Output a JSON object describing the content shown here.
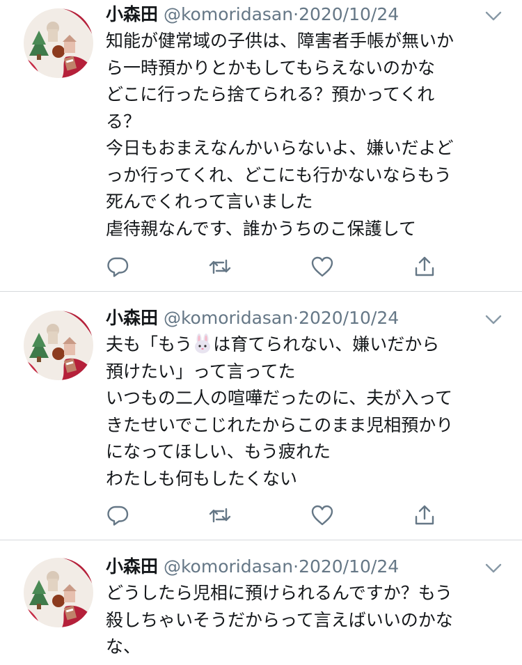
{
  "tweets": [
    {
      "name": "小森田",
      "handle": "@komoridasan",
      "sep": "·",
      "date": "2020/10/24",
      "lines": [
        "知能が健常域の子供は、障害者手帳が無いか",
        "ら一時預かりとかもしてもらえないのかな",
        "どこに行ったら捨てられる？預かってくれ",
        "る？",
        "今日もおまえなんかいらないよ、嫌いだよど",
        "っか行ってくれ、どこにも行かないならもう",
        "死んでくれって言いました",
        "虐待親なんです、誰かうちのこ保護して"
      ]
    },
    {
      "name": "小森田",
      "handle": "@komoridasan",
      "sep": "·",
      "date": "2020/10/24",
      "line1_pre": "夫も「もう",
      "line1_emoji": "rabbit-face-emoji",
      "line1_post": "は育てられない、嫌いだから",
      "lines": [
        "預けたい」って言ってた",
        "いつもの二人の喧嘩だったのに、夫が入って",
        "きたせいでこじれたからこのまま児相預かり",
        "になってほしい、もう疲れた",
        "わたしも何もしたくない"
      ]
    },
    {
      "name": "小森田",
      "handle": "@komoridasan",
      "sep": "·",
      "date": "2020/10/24",
      "lines": [
        "どうしたら児相に預けられるんですか？もう",
        "殺しちゃいそうだからって言えばいいのかな",
        "な、"
      ]
    }
  ],
  "icons": {
    "reply": "reply-icon",
    "retweet": "retweet-icon",
    "like": "heart-icon",
    "share": "share-icon",
    "more": "chevron-down-icon"
  },
  "colors": {
    "text": "#14171a",
    "secondary": "#657786",
    "divider": "#d6d9dc"
  }
}
